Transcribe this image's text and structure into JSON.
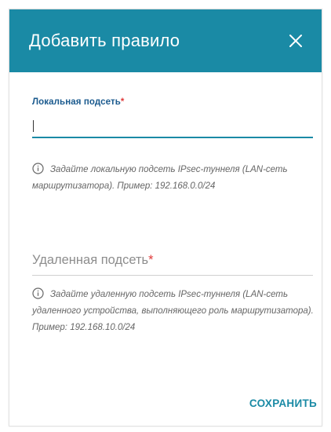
{
  "dialog": {
    "title": "Добавить правило",
    "colors": {
      "accent": "#1a8aa5",
      "label": "#1a5a8e",
      "required": "#e03b3b"
    }
  },
  "local_subnet": {
    "label": "Локальная подсеть",
    "required_mark": "*",
    "value": "",
    "hint": "Задайте локальную подсеть IPsec-туннеля (LAN-сеть маршрутизатора). Пример: 192.168.0.0/24"
  },
  "remote_subnet": {
    "placeholder": "Удаленная подсеть",
    "required_mark": "*",
    "hint": "Задайте удаленную подсеть IPsec-туннеля (LAN-сеть удаленного устройства, выполняющего роль маршрутизатора). Пример: 192.168.10.0/24"
  },
  "actions": {
    "save_label": "СОХРАНИТЬ"
  },
  "icons": {
    "close": "close-icon",
    "info": "info-icon"
  }
}
